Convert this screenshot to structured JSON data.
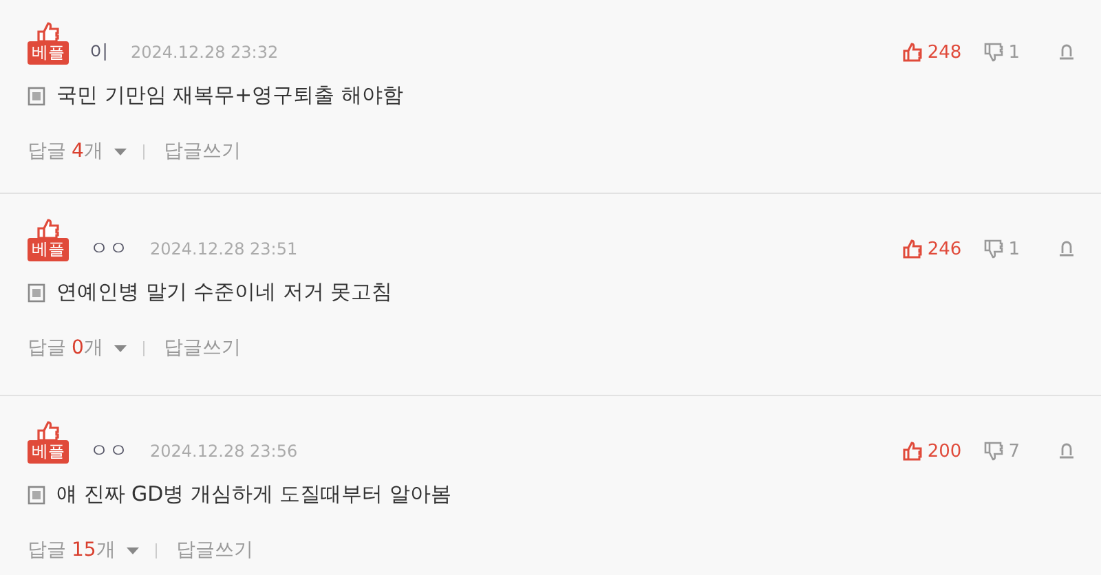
{
  "comments": [
    {
      "badge": "베플",
      "author": "이",
      "date": "2024.12.28 23:32",
      "likes": "248",
      "dislikes": "1",
      "text": "국민 기만임 재복무+영구퇴출 해야함",
      "reply_label": "답글",
      "reply_count": "4",
      "reply_unit": "개",
      "write_reply": "답글쓰기"
    },
    {
      "badge": "베플",
      "author": "ㅇㅇ",
      "date": "2024.12.28 23:51",
      "likes": "246",
      "dislikes": "1",
      "text": "연예인병 말기 수준이네 저거 못고침",
      "reply_label": "답글",
      "reply_count": "0",
      "reply_unit": "개",
      "write_reply": "답글쓰기"
    },
    {
      "badge": "베플",
      "author": "ㅇㅇ",
      "date": "2024.12.28 23:56",
      "likes": "200",
      "dislikes": "7",
      "text": "얘 진짜 GD병 개심하게 도질때부터 알아봄",
      "reply_label": "답글",
      "reply_count": "15",
      "reply_unit": "개",
      "write_reply": "답글쓰기"
    }
  ]
}
